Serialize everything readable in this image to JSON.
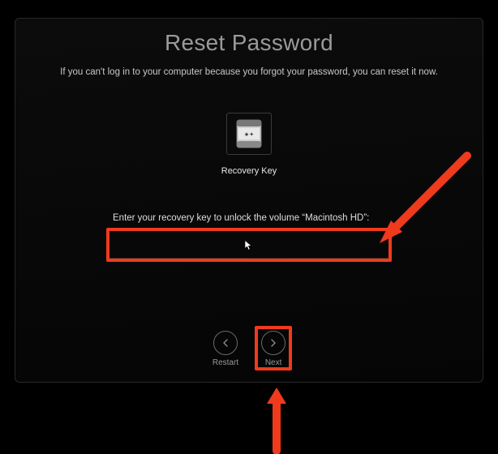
{
  "dialog": {
    "title": "Reset Password",
    "subtitle": "If you can't log in to your computer because you forgot your password, you can reset it now.",
    "recovery_key_label": "Recovery Key",
    "prompt": "Enter your recovery key to unlock the volume “Macintosh HD”:",
    "input_value": ""
  },
  "buttons": {
    "restart": "Restart",
    "next": "Next"
  },
  "colors": {
    "highlight": "#f03a1d"
  }
}
